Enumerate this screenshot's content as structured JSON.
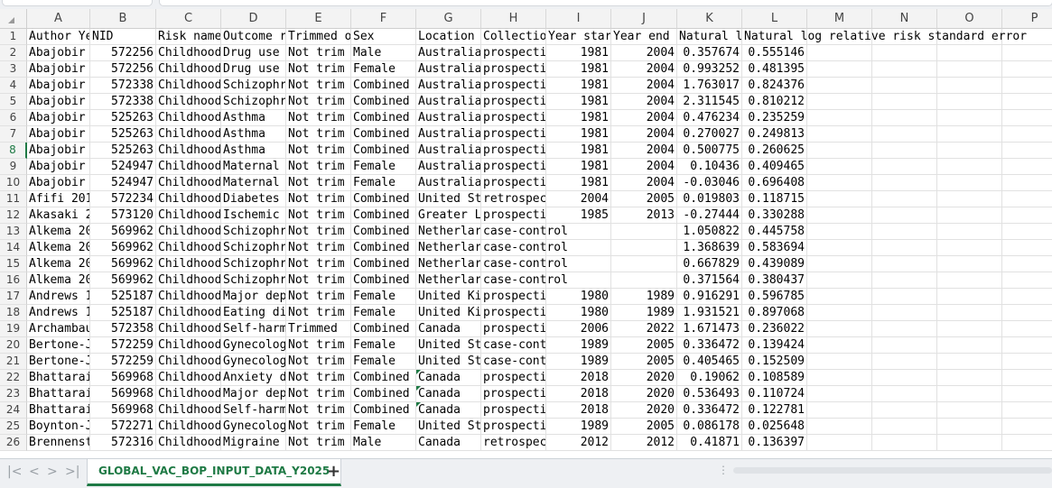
{
  "sheet": {
    "active_tab": "GLOBAL_VAC_BOP_INPUT_DATA_Y2025",
    "add_sheet": "+",
    "nav": {
      "first": "|<",
      "prev": "<",
      "next": ">",
      "last": ">|"
    }
  },
  "columns": [
    "A",
    "B",
    "C",
    "D",
    "E",
    "F",
    "G",
    "H",
    "I",
    "J",
    "K",
    "L",
    "M",
    "N",
    "O",
    "P"
  ],
  "rows": [
    {
      "n": "1",
      "c": [
        "Author Year",
        "NID",
        "Risk name",
        "Outcome r",
        "Trimmed o",
        "Sex",
        "Location",
        "Collectio",
        "Year star",
        "Year end",
        "Natural l",
        "Natural log relative risk standard error",
        "",
        "",
        "",
        ""
      ]
    },
    {
      "n": "2",
      "c": [
        "Abajobir",
        "572256",
        "Childhood",
        "Drug use",
        "Not trim",
        "Male",
        "Australia",
        "prospecti",
        "1981",
        "2004",
        "0.357674",
        "0.555146",
        "",
        "",
        "",
        ""
      ]
    },
    {
      "n": "3",
      "c": [
        "Abajobir",
        "572256",
        "Childhood",
        "Drug use",
        "Not trim",
        "Female",
        "Australia",
        "prospecti",
        "1981",
        "2004",
        "0.993252",
        "0.481395",
        "",
        "",
        "",
        ""
      ]
    },
    {
      "n": "4",
      "c": [
        "Abajobir",
        "572338",
        "Childhood",
        "Schizophr",
        "Not trim",
        "Combined",
        "Australia",
        "prospecti",
        "1981",
        "2004",
        "1.763017",
        "0.824376",
        "",
        "",
        "",
        ""
      ]
    },
    {
      "n": "5",
      "c": [
        "Abajobir",
        "572338",
        "Childhood",
        "Schizophr",
        "Not trim",
        "Combined",
        "Australia",
        "prospecti",
        "1981",
        "2004",
        "2.311545",
        "0.810212",
        "",
        "",
        "",
        ""
      ]
    },
    {
      "n": "6",
      "c": [
        "Abajobir",
        "525263",
        "Childhood",
        "Asthma",
        "Not trim",
        "Combined",
        "Australia",
        "prospecti",
        "1981",
        "2004",
        "0.476234",
        "0.235259",
        "",
        "",
        "",
        ""
      ]
    },
    {
      "n": "7",
      "c": [
        "Abajobir",
        "525263",
        "Childhood",
        "Asthma",
        "Not trim",
        "Combined",
        "Australia",
        "prospecti",
        "1981",
        "2004",
        "0.270027",
        "0.249813",
        "",
        "",
        "",
        ""
      ]
    },
    {
      "n": "8",
      "c": [
        "Abajobir",
        "525263",
        "Childhood",
        "Asthma",
        "Not trim",
        "Combined",
        "Australia",
        "prospecti",
        "1981",
        "2004",
        "0.500775",
        "0.260625",
        "",
        "",
        "",
        ""
      ]
    },
    {
      "n": "9",
      "c": [
        "Abajobir",
        "524947",
        "Childhood",
        "Maternal",
        "Not trim",
        "Female",
        "Australia",
        "prospecti",
        "1981",
        "2004",
        "0.10436",
        "0.409465",
        "",
        "",
        "",
        ""
      ]
    },
    {
      "n": "10",
      "c": [
        "Abajobir",
        "524947",
        "Childhood",
        "Maternal",
        "Not trim",
        "Female",
        "Australia",
        "prospecti",
        "1981",
        "2004",
        "-0.03046",
        "0.696408",
        "",
        "",
        "",
        ""
      ]
    },
    {
      "n": "11",
      "c": [
        "Afifi 201",
        "572234",
        "Childhood",
        "Diabetes",
        "Not trim",
        "Combined",
        "United St",
        "retrospec",
        "2004",
        "2005",
        "0.019803",
        "0.118715",
        "",
        "",
        "",
        ""
      ]
    },
    {
      "n": "12",
      "c": [
        "Akasaki 2",
        "573120",
        "Childhood",
        "Ischemic",
        "Not trim",
        "Combined",
        "Greater L",
        "prospecti",
        "1985",
        "2013",
        "-0.27444",
        "0.330288",
        "",
        "",
        "",
        ""
      ]
    },
    {
      "n": "13",
      "c": [
        "Alkema 20",
        "569962",
        "Childhood",
        "Schizophr",
        "Not trim",
        "Combined",
        "Netherlar",
        "case-control",
        "",
        "",
        "1.050822",
        "0.445758",
        "",
        "",
        "",
        ""
      ]
    },
    {
      "n": "14",
      "c": [
        "Alkema 20",
        "569962",
        "Childhood",
        "Schizophr",
        "Not trim",
        "Combined",
        "Netherlar",
        "case-control",
        "",
        "",
        "1.368639",
        "0.583694",
        "",
        "",
        "",
        ""
      ]
    },
    {
      "n": "15",
      "c": [
        "Alkema 20",
        "569962",
        "Childhood",
        "Schizophr",
        "Not trim",
        "Combined",
        "Netherlar",
        "case-control",
        "",
        "",
        "0.667829",
        "0.439089",
        "",
        "",
        "",
        ""
      ]
    },
    {
      "n": "16",
      "c": [
        "Alkema 20",
        "569962",
        "Childhood",
        "Schizophr",
        "Not trim",
        "Combined",
        "Netherlar",
        "case-control",
        "",
        "",
        "0.371564",
        "0.380437",
        "",
        "",
        "",
        ""
      ]
    },
    {
      "n": "17",
      "c": [
        "Andrews 1",
        "525187",
        "Childhood",
        "Major dep",
        "Not trim",
        "Female",
        "United Ki",
        "prospecti",
        "1980",
        "1989",
        "0.916291",
        "0.596785",
        "",
        "",
        "",
        ""
      ]
    },
    {
      "n": "18",
      "c": [
        "Andrews 1",
        "525187",
        "Childhood",
        "Eating di",
        "Not trim",
        "Female",
        "United Ki",
        "prospecti",
        "1980",
        "1989",
        "1.931521",
        "0.897068",
        "",
        "",
        "",
        ""
      ]
    },
    {
      "n": "19",
      "c": [
        "Archambau",
        "572358",
        "Childhood",
        "Self-harm",
        "Trimmed",
        "Combined",
        "Canada",
        "prospecti",
        "2006",
        "2022",
        "1.671473",
        "0.236022",
        "",
        "",
        "",
        ""
      ]
    },
    {
      "n": "20",
      "c": [
        "Bertone-J",
        "572259",
        "Childhood",
        "Gynecolog",
        "Not trim",
        "Female",
        "United St",
        "case-cont",
        "1989",
        "2005",
        "0.336472",
        "0.139424",
        "",
        "",
        "",
        ""
      ]
    },
    {
      "n": "21",
      "c": [
        "Bertone-J",
        "572259",
        "Childhood",
        "Gynecolog",
        "Not trim",
        "Female",
        "United St",
        "case-cont",
        "1989",
        "2005",
        "0.405465",
        "0.152509",
        "",
        "",
        "",
        ""
      ]
    },
    {
      "n": "22",
      "c": [
        "Bhattarai",
        "569968",
        "Childhood",
        "Anxiety d",
        "Not trim",
        "Combined",
        "Canada",
        "prospecti",
        "2018",
        "2020",
        "0.19062",
        "0.108589",
        "",
        "",
        "",
        ""
      ]
    },
    {
      "n": "23",
      "c": [
        "Bhattarai",
        "569968",
        "Childhood",
        "Major dep",
        "Not trim",
        "Combined",
        "Canada",
        "prospecti",
        "2018",
        "2020",
        "0.536493",
        "0.110724",
        "",
        "",
        "",
        ""
      ]
    },
    {
      "n": "24",
      "c": [
        "Bhattarai",
        "569968",
        "Childhood",
        "Self-harm",
        "Not trim",
        "Combined",
        "Canada",
        "prospecti",
        "2018",
        "2020",
        "0.336472",
        "0.122781",
        "",
        "",
        "",
        ""
      ]
    },
    {
      "n": "25",
      "c": [
        "Boynton-J",
        "572271",
        "Childhood",
        "Gynecolog",
        "Not trim",
        "Female",
        "United St",
        "prospecti",
        "1989",
        "2005",
        "0.086178",
        "0.025648",
        "",
        "",
        "",
        ""
      ]
    },
    {
      "n": "26",
      "c": [
        "Brennenst",
        "572316",
        "Childhood",
        "Migraine",
        "Not trim",
        "Male",
        "Canada",
        "retrospec",
        "2012",
        "2012",
        "0.41871",
        "0.136397",
        "",
        "",
        "",
        ""
      ]
    }
  ]
}
